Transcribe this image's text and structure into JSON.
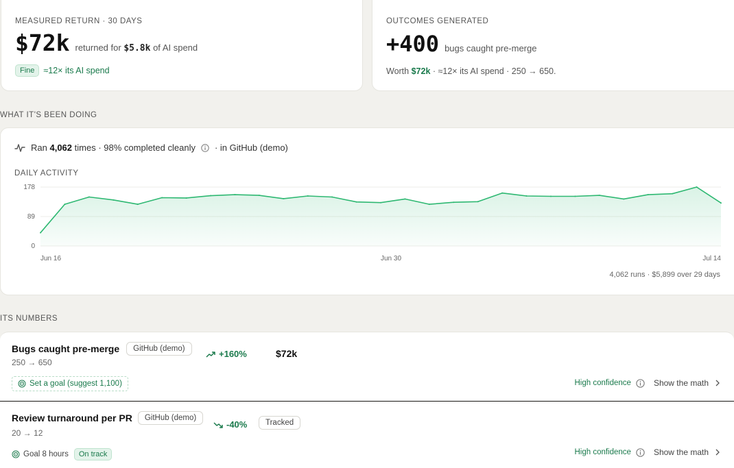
{
  "measured": {
    "eyebrow": "MEASURED RETURN · 30 DAYS",
    "big_value": "$72k",
    "text_pre": "returned for",
    "spend": "$5.8k",
    "text_post": "of AI spend",
    "badge": "Fine",
    "multiplier": "≈12× its AI spend"
  },
  "outcomes": {
    "eyebrow": "OUTCOMES GENERATED",
    "big_value": "+400",
    "label": "bugs caught pre-merge",
    "worth_label": "Worth",
    "worth_value": "$72k",
    "worth_rest": "· ≈12× its AI spend · 250 → 650."
  },
  "doing": {
    "section_label": "WHAT IT'S BEEN DOING",
    "ran_label": "Ran",
    "ran_count": "4,062",
    "ran_rest": "times · 98% completed cleanly",
    "ran_where": "· in GitHub (demo)",
    "daily_label": "DAILY ACTIVITY",
    "footer": "4,062 runs · $5,899 over 29 days"
  },
  "chart_data": {
    "type": "area",
    "title": "DAILY ACTIVITY",
    "ylim": [
      0,
      178
    ],
    "yticks": [
      "178",
      "89",
      "0"
    ],
    "xticks": [
      "Jun 16",
      "Jun 30",
      "Jul 14"
    ],
    "x": [
      "Jun 16",
      "Jun 17",
      "Jun 18",
      "Jun 19",
      "Jun 20",
      "Jun 21",
      "Jun 22",
      "Jun 23",
      "Jun 24",
      "Jun 25",
      "Jun 26",
      "Jun 27",
      "Jun 28",
      "Jun 29",
      "Jun 30",
      "Jul 1",
      "Jul 2",
      "Jul 3",
      "Jul 4",
      "Jul 5",
      "Jul 6",
      "Jul 7",
      "Jul 8",
      "Jul 9",
      "Jul 10",
      "Jul 11",
      "Jul 12",
      "Jul 13",
      "Jul 14"
    ],
    "values": [
      40,
      126,
      148,
      139,
      126,
      146,
      145,
      152,
      155,
      153,
      143,
      151,
      148,
      133,
      131,
      142,
      126,
      132,
      134,
      160,
      151,
      150,
      150,
      153,
      142,
      155,
      158,
      178,
      130
    ],
    "color": "#2eb872",
    "grid": true
  },
  "numbers": {
    "section_label": "ITS NUMBERS",
    "rows": [
      {
        "title": "Bugs caught pre-merge",
        "source": "GitHub (demo)",
        "change": "+160%",
        "value": "$72k",
        "range": "250 → 650",
        "goal": "Set a goal (suggest 1,100)",
        "confidence": "High confidence",
        "math": "Show the math"
      },
      {
        "title": "Review turnaround per PR",
        "source": "GitHub (demo)",
        "change": "-40%",
        "tag": "Tracked",
        "range": "20 → 12",
        "goal": "Goal 8 hours",
        "goal_badge": "On track",
        "confidence": "High confidence",
        "math": "Show the math"
      }
    ]
  }
}
